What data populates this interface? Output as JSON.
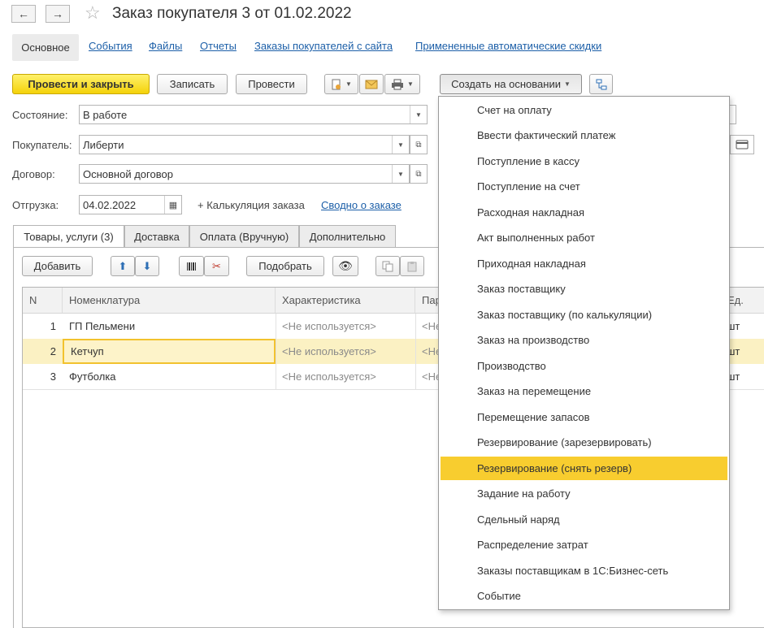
{
  "window": {
    "title": "Заказ покупателя 3 от 01.02.2022"
  },
  "nav": {
    "back_icon": "←",
    "forward_icon": "→",
    "star_icon": "☆"
  },
  "top_tabs": [
    "Основное",
    "События",
    "Файлы",
    "Отчеты",
    "Заказы покупателей с сайта",
    "Примененные автоматические скидки"
  ],
  "toolbar": {
    "post_close": "Провести и закрыть",
    "save": "Записать",
    "post": "Провести",
    "create_based": "Создать на основании"
  },
  "form": {
    "state_label": "Состояние:",
    "state_value": "В работе",
    "customer_label": "Покупатель:",
    "customer_value": "Либерти",
    "contract_label": "Договор:",
    "contract_value": "Основной договор",
    "shipment_label": "Отгрузка:",
    "shipment_value": "04.02.2022",
    "calc_link": "+ Калькуляция заказа",
    "summary_link": "Сводно о заказе"
  },
  "lower_tabs": [
    "Товары, услуги (3)",
    "Доставка",
    "Оплата (Вручную)",
    "Дополнительно"
  ],
  "table_toolbar": {
    "add": "Добавить",
    "pick": "Подобрать"
  },
  "table": {
    "columns": [
      "N",
      "Номенклатура",
      "Характеристика",
      "Пар",
      "Ед."
    ],
    "rows": [
      {
        "n": "1",
        "item": "ГП Пельмени",
        "char": "<Не используется>",
        "par": "<Не",
        "unit": "шт"
      },
      {
        "n": "2",
        "item": "Кетчуп",
        "char": "<Не используется>",
        "par": "<Не",
        "unit": "шт"
      },
      {
        "n": "3",
        "item": "Футболка",
        "char": "<Не используется>",
        "par": "<Не",
        "unit": "шт"
      }
    ]
  },
  "menu": {
    "items": [
      "Счет на оплату",
      "Ввести фактический платеж",
      "Поступление в кассу",
      "Поступление на счет",
      "Расходная накладная",
      "Акт выполненных работ",
      "Приходная накладная",
      "Заказ поставщику",
      "Заказ поставщику (по калькуляции)",
      "Заказ на производство",
      "Производство",
      "Заказ на перемещение",
      "Перемещение запасов",
      "Резервирование (зарезервировать)",
      "Резервирование (снять резерв)",
      "Задание на работу",
      "Сдельный наряд",
      "Распределение затрат",
      "Заказы поставщикам в 1С:Бизнес-сеть",
      "Событие"
    ],
    "highlighted_index": 14
  },
  "colors": {
    "primary": "#f4d20a",
    "highlight": "#f8cd2f",
    "link": "#1c5fa8",
    "selected_row": "#fbf1c3"
  }
}
